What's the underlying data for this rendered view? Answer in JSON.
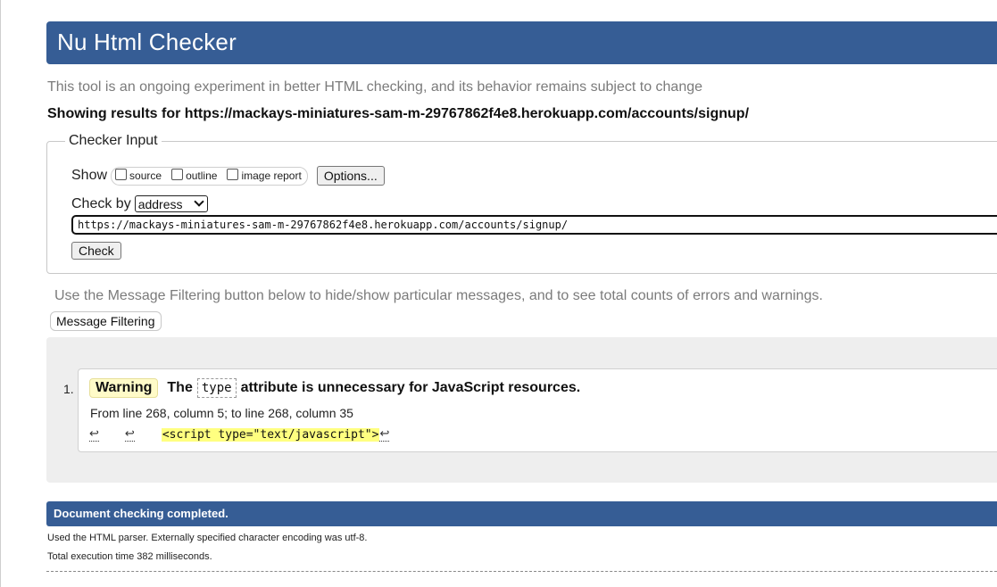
{
  "header": {
    "title": "Nu Html Checker"
  },
  "tagline": "This tool is an ongoing experiment in better HTML checking, and its behavior remains subject to change",
  "results_for": "Showing results for https://mackays-miniatures-sam-m-29767862f4e8.herokuapp.com/accounts/signup/",
  "checker_input": {
    "legend": "Checker Input",
    "show_label": "Show",
    "show_options": [
      {
        "label": "source",
        "checked": false
      },
      {
        "label": "outline",
        "checked": false
      },
      {
        "label": "image report",
        "checked": false
      }
    ],
    "options_button": "Options...",
    "check_by_label": "Check by",
    "check_by_value": "address",
    "url_value": "https://mackays-miniatures-sam-m-29767862f4e8.herokuapp.com/accounts/signup/",
    "check_button": "Check"
  },
  "filter": {
    "hint": "Use the Message Filtering button below to hide/show particular messages, and to see total counts of errors and warnings.",
    "button": "Message Filtering"
  },
  "messages": [
    {
      "number": "1.",
      "type": "Warning",
      "text_before": "The",
      "code": "type",
      "text_after": "attribute is unnecessary for JavaScript resources.",
      "location": "From line 268, column 5; to line 268, column 35",
      "linefeed_glyph": "↩",
      "extract_code": "<script type=\"text/javascript\">"
    }
  ],
  "footer": {
    "done": "Document checking completed.",
    "parser_info": "Used the HTML parser. Externally specified character encoding was utf-8.",
    "time_info": "Total execution time 382 milliseconds."
  },
  "colors": {
    "header_bg": "#365d95",
    "warning_bg": "#fffbc8",
    "highlight": "#ffff80"
  }
}
